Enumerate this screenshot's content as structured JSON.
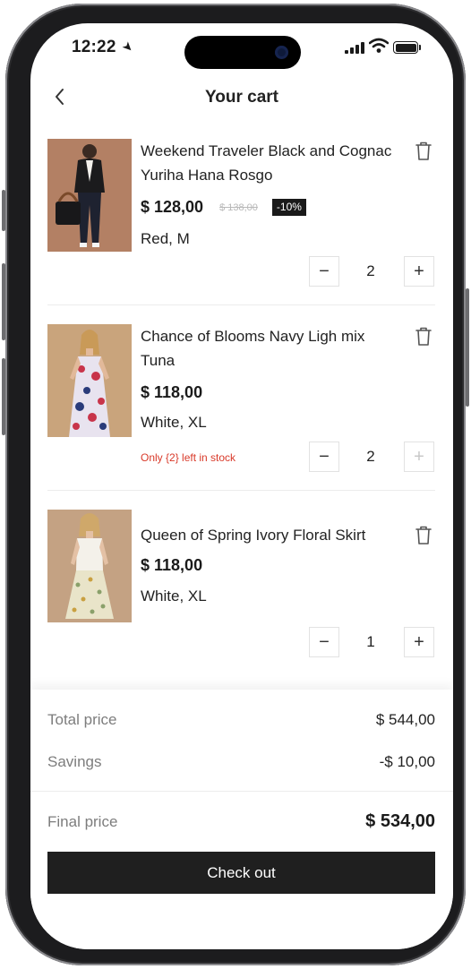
{
  "status_bar": {
    "time": "12:22"
  },
  "header": {
    "title": "Your cart",
    "back_icon": "‹"
  },
  "cart": {
    "items": [
      {
        "name": "Weekend Traveler Black and Cognac Yuriha Hana Rosgo",
        "price": "$ 128,00",
        "old_price": "$ 138,00",
        "discount": "-10%",
        "variant": "Red, M",
        "quantity": "2",
        "minus": "−",
        "plus": "+"
      },
      {
        "name": "Chance of Blooms Navy Ligh mix Tuna",
        "price": "$ 118,00",
        "variant": "White, XL",
        "stock_warning": "Only {2} left in stock",
        "quantity": "2",
        "minus": "−",
        "plus": "+"
      },
      {
        "name": "Queen of Spring Ivory Floral Skirt",
        "price": "$ 118,00",
        "variant": "White, XL",
        "quantity": "1",
        "minus": "−",
        "plus": "+"
      }
    ]
  },
  "summary": {
    "total_label": "Total price",
    "total_value": "$ 544,00",
    "savings_label": "Savings",
    "savings_value": "-$ 10,00",
    "final_label": "Final price",
    "final_value": "$ 534,00",
    "checkout_label": "Check out"
  },
  "colors": {
    "accent": "#1f1f1f",
    "warning": "#d93a2a",
    "muted": "#7d7d7d"
  }
}
